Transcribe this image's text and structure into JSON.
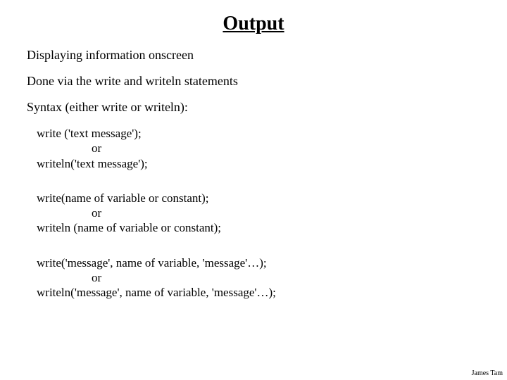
{
  "title": "Output",
  "lines": {
    "l1": "Displaying information onscreen",
    "l2": "Done via the write and writeln statements",
    "l3": "Syntax (either write or writeln):"
  },
  "blocks": {
    "b1": {
      "a": "write ('text message');",
      "or": "or",
      "b": "writeln('text message');"
    },
    "b2": {
      "a": "write(name of variable or constant);",
      "or": "or",
      "b": "writeln (name of variable or constant);"
    },
    "b3": {
      "a": "write('message', name of variable, 'message'…);",
      "or": "or",
      "b": "writeln('message', name of variable, 'message'…);"
    }
  },
  "footer": "James Tam"
}
